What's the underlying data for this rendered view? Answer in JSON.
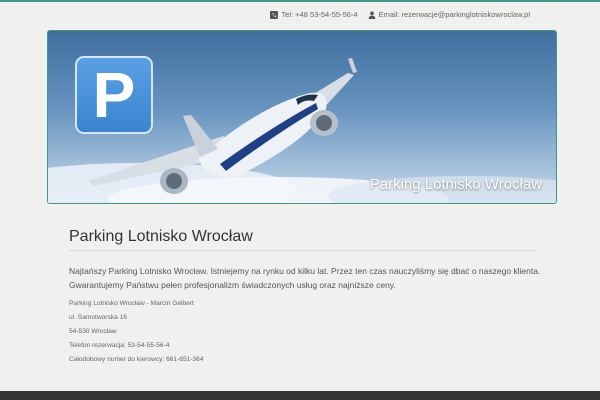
{
  "header": {
    "phone": "Tel: +48 53-54-55-56-4",
    "phone_icon": "phone-icon",
    "email": "Email: rezerwacje@parkinglotniskowroclaw.pl",
    "email_icon": "user-icon"
  },
  "hero": {
    "badge_letter": "P",
    "caption": "Parking Lotnisko Wrocław"
  },
  "content": {
    "title": "Parking Lotnisko Wrocław",
    "intro_line1": "Najtańszy Parking Lotnisko Wrocław. Istniejemy na rynku od kilku lat. Przez ten czas nauczyliśmy się dbać o naszego klienta.",
    "intro_line2": "Gwarantujemy Państwu pełen profesjonalizm świadczonych usług oraz najniższe ceny.",
    "address_lines": [
      "Parking Lotnisko Wrocław - Marcin Gelbert",
      "ul. Samotworska 16",
      "54-530 Wrocław",
      "Telefon rezerwacja: 53-54-55-56-4",
      "Całodobowy numer do kierowcy: 661-651-364"
    ]
  },
  "colors": {
    "accent": "#3d9a8b",
    "background": "#f0f0ef",
    "footer": "#333333"
  }
}
